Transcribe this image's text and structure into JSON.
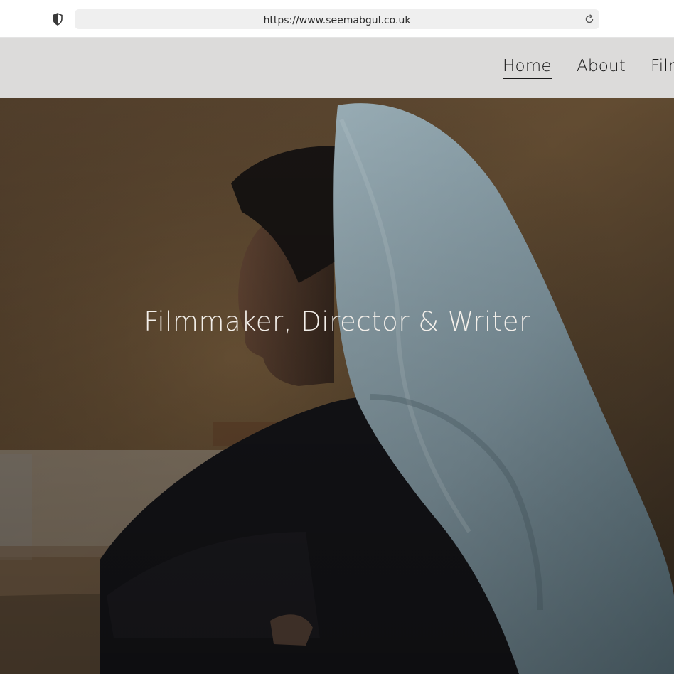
{
  "browser": {
    "url": "https://www.seemabgul.co.uk",
    "icons": {
      "security": "shield-icon",
      "reload": "reload-icon"
    }
  },
  "nav": {
    "items": [
      {
        "label": "Home",
        "active": true
      },
      {
        "label": "About",
        "active": false
      },
      {
        "label": "Films",
        "active": false
      }
    ]
  },
  "hero": {
    "title": "Filmmaker, Director & Writer",
    "image": "woman-in-light-blue-headscarf-looking-left"
  },
  "colors": {
    "header_bg": "#dcdbda",
    "hero_text": "#f3efea",
    "nav_text": "#1a1a1a"
  }
}
